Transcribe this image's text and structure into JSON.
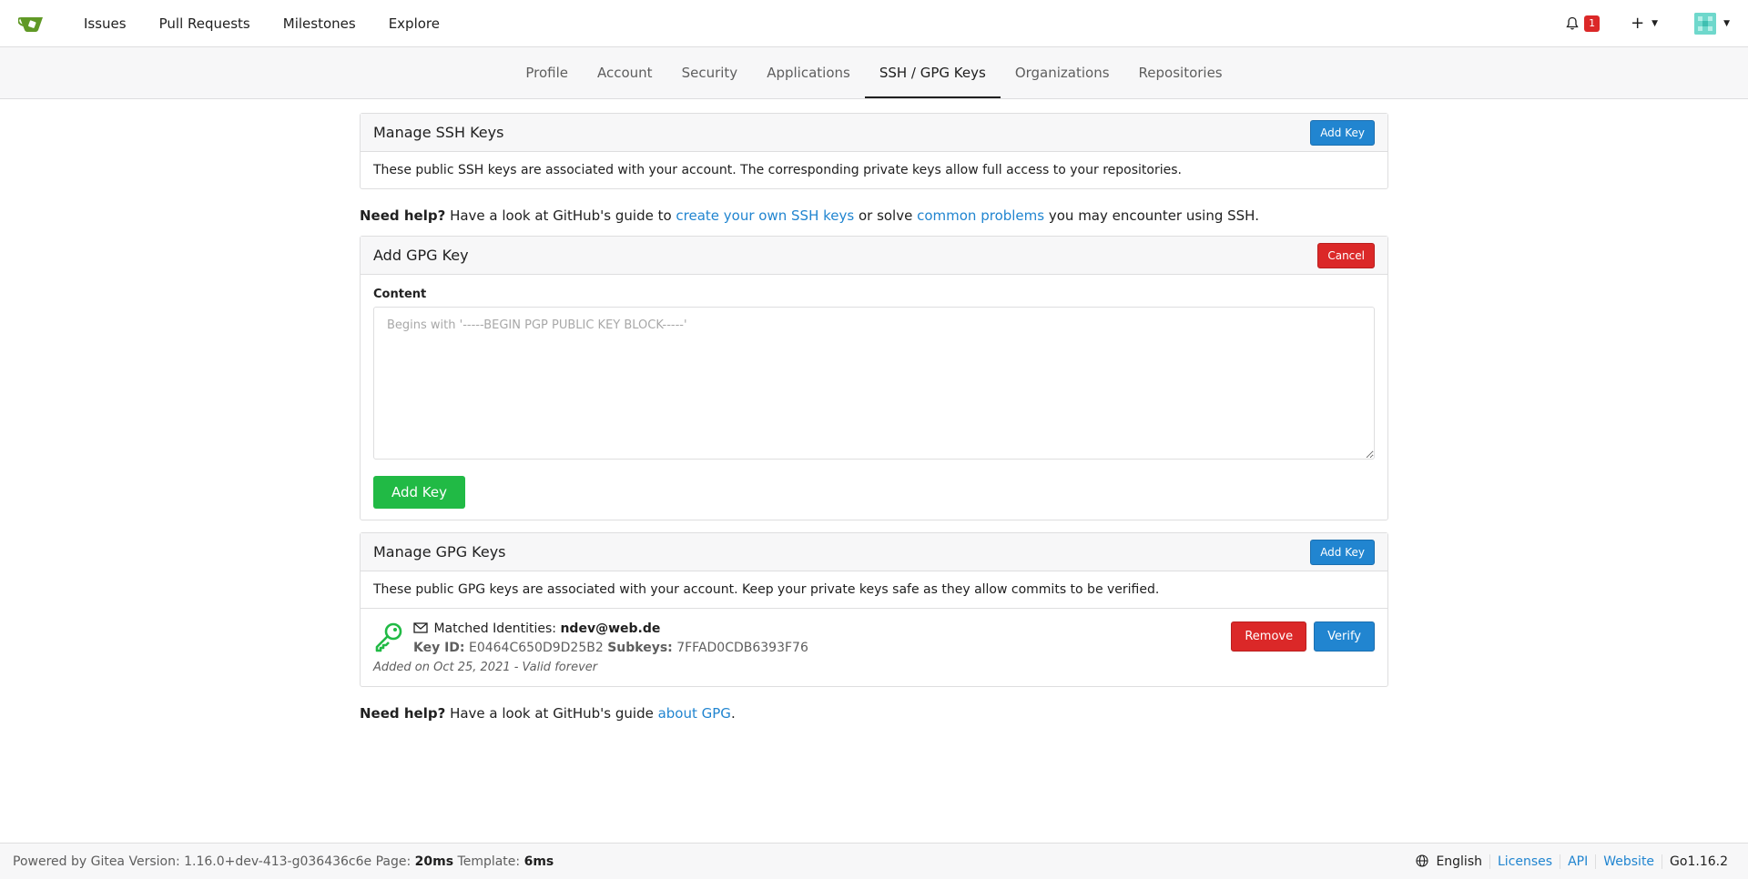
{
  "topnav": {
    "items": [
      "Issues",
      "Pull Requests",
      "Milestones",
      "Explore"
    ],
    "notification_count": "1"
  },
  "subnav": {
    "tabs": [
      "Profile",
      "Account",
      "Security",
      "Applications",
      "SSH / GPG Keys",
      "Organizations",
      "Repositories"
    ],
    "active": "SSH / GPG Keys"
  },
  "ssh": {
    "title": "Manage SSH Keys",
    "add_label": "Add Key",
    "description": "These public SSH keys are associated with your account. The corresponding private keys allow full access to your repositories."
  },
  "ssh_help": {
    "bold": "Need help?",
    "text1": " Have a look at GitHub's guide to ",
    "link1": "create your own SSH keys",
    "text2": " or solve ",
    "link2": "common problems",
    "text3": " you may encounter using SSH."
  },
  "add_gpg": {
    "title": "Add GPG Key",
    "cancel_label": "Cancel",
    "content_label": "Content",
    "placeholder": "Begins with '-----BEGIN PGP PUBLIC KEY BLOCK-----'",
    "submit_label": "Add Key"
  },
  "gpg": {
    "title": "Manage GPG Keys",
    "add_label": "Add Key",
    "description": "These public GPG keys are associated with your account. Keep your private keys safe as they allow commits to be verified.",
    "key": {
      "identities_label": "Matched Identities:",
      "email": "ndev@web.de",
      "key_id_label": "Key ID:",
      "key_id": "E0464C650D9D25B2",
      "subkeys_label": "Subkeys:",
      "subkeys": "7FFAD0CDB6393F76",
      "added": "Added on Oct 25, 2021 - Valid forever",
      "remove_label": "Remove",
      "verify_label": "Verify"
    }
  },
  "gpg_help": {
    "bold": "Need help?",
    "text1": " Have a look at GitHub's guide ",
    "link1": "about GPG",
    "text2": "."
  },
  "footer": {
    "powered": "Powered by Gitea Version: 1.16.0+dev-413-g036436c6e Page: ",
    "page_time": "20ms",
    "template_label": " Template: ",
    "template_time": "6ms",
    "language": "English",
    "licenses": "Licenses",
    "api": "API",
    "website": "Website",
    "go_version": "Go1.16.2"
  },
  "colors": {
    "primary": "#2185d0",
    "danger": "#db2828",
    "success": "#21ba45"
  }
}
